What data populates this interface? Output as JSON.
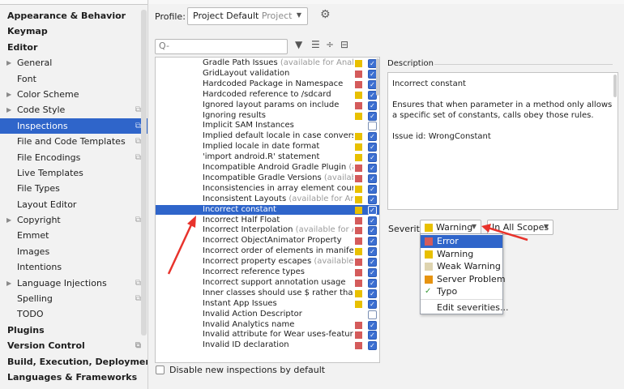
{
  "sidebar": {
    "items": [
      {
        "label": "Appearance & Behavior",
        "level": 0,
        "bold": true
      },
      {
        "label": "Keymap",
        "level": 0,
        "bold": true
      },
      {
        "label": "Editor",
        "level": 0,
        "bold": true
      },
      {
        "label": "General",
        "level": 1,
        "arrow": true
      },
      {
        "label": "Font",
        "level": 1
      },
      {
        "label": "Color Scheme",
        "level": 1,
        "arrow": true
      },
      {
        "label": "Code Style",
        "level": 1,
        "arrow": true,
        "project": true
      },
      {
        "label": "Inspections",
        "level": 1,
        "project": true,
        "selected": true
      },
      {
        "label": "File and Code Templates",
        "level": 1,
        "project": true
      },
      {
        "label": "File Encodings",
        "level": 1,
        "project": true
      },
      {
        "label": "Live Templates",
        "level": 1
      },
      {
        "label": "File Types",
        "level": 1
      },
      {
        "label": "Layout Editor",
        "level": 1
      },
      {
        "label": "Copyright",
        "level": 1,
        "arrow": true,
        "project": true
      },
      {
        "label": "Emmet",
        "level": 1
      },
      {
        "label": "Images",
        "level": 1
      },
      {
        "label": "Intentions",
        "level": 1
      },
      {
        "label": "Language Injections",
        "level": 1,
        "arrow": true,
        "project": true
      },
      {
        "label": "Spelling",
        "level": 1,
        "project": true
      },
      {
        "label": "TODO",
        "level": 1
      },
      {
        "label": "Plugins",
        "level": 0,
        "bold": true
      },
      {
        "label": "Version Control",
        "level": 0,
        "bold": true,
        "project": true
      },
      {
        "label": "Build, Execution, Deployment",
        "level": 0,
        "bold": true
      },
      {
        "label": "Languages & Frameworks",
        "level": 0,
        "bold": true
      }
    ]
  },
  "profile": {
    "label": "Profile:",
    "value": "Project Default",
    "value_suffix": "Project"
  },
  "search": {
    "placeholder": "Q-"
  },
  "severity_colors": {
    "error": "#d45b5b",
    "warning": "#e8c000",
    "weak": "#ded4b0",
    "server": "#e69310"
  },
  "inspections": [
    {
      "name": "Gradle Path Issues",
      "note": "(available for Analyze",
      "sev": "warning",
      "on": true
    },
    {
      "name": "GridLayout validation",
      "note": "",
      "sev": "error",
      "on": true
    },
    {
      "name": "Hardcoded Package in Namespace",
      "note": "",
      "sev": "error",
      "on": true
    },
    {
      "name": "Hardcoded reference to /sdcard",
      "note": "",
      "sev": "warning",
      "on": true
    },
    {
      "name": "Ignored layout params on include",
      "note": "",
      "sev": "error",
      "on": true
    },
    {
      "name": "Ignoring results",
      "note": "",
      "sev": "warning",
      "on": true
    },
    {
      "name": "Implicit SAM Instances",
      "note": "",
      "sev": "",
      "on": false
    },
    {
      "name": "Implied default locale in case conversion",
      "note": "",
      "sev": "warning",
      "on": true
    },
    {
      "name": "Implied locale in date format",
      "note": "",
      "sev": "warning",
      "on": true
    },
    {
      "name": "'import android.R' statement",
      "note": "",
      "sev": "warning",
      "on": true
    },
    {
      "name": "Incompatible Android Gradle Plugin",
      "note": "(avai",
      "sev": "error",
      "on": true
    },
    {
      "name": "Incompatible Gradle Versions",
      "note": "(available f",
      "sev": "error",
      "on": true
    },
    {
      "name": "Inconsistencies in array element counts",
      "note": "",
      "sev": "warning",
      "on": true
    },
    {
      "name": "Inconsistent Layouts",
      "note": "(available for Analyz",
      "sev": "warning",
      "on": true
    },
    {
      "name": "Incorrect constant",
      "note": "",
      "sev": "warning",
      "on": true,
      "selected": true
    },
    {
      "name": "Incorrect Half Float",
      "note": "",
      "sev": "error",
      "on": true
    },
    {
      "name": "Incorrect Interpolation",
      "note": "(available for Anal",
      "sev": "error",
      "on": true
    },
    {
      "name": "Incorrect ObjectAnimator Property",
      "note": "",
      "sev": "error",
      "on": true
    },
    {
      "name": "Incorrect order of elements in manifest",
      "note": "",
      "sev": "warning",
      "on": true
    },
    {
      "name": "Incorrect property escapes",
      "note": "(available for",
      "sev": "error",
      "on": true
    },
    {
      "name": "Incorrect reference types",
      "note": "",
      "sev": "error",
      "on": true
    },
    {
      "name": "Incorrect support annotation usage",
      "note": "",
      "sev": "error",
      "on": true
    },
    {
      "name": "Inner classes should use $ rather than .",
      "note": "",
      "sev": "warning",
      "on": true
    },
    {
      "name": "Instant App Issues",
      "note": "",
      "sev": "warning",
      "on": true
    },
    {
      "name": "Invalid Action Descriptor",
      "note": "",
      "sev": "",
      "on": false
    },
    {
      "name": "Invalid Analytics name",
      "note": "",
      "sev": "error",
      "on": true
    },
    {
      "name": "Invalid attribute for Wear uses-feature",
      "note": "",
      "sev": "error",
      "on": true
    },
    {
      "name": "Invalid ID declaration",
      "note": "",
      "sev": "error",
      "on": true
    }
  ],
  "description": {
    "label": "Description",
    "title": "Incorrect constant",
    "body": "Ensures that when parameter in a method only allows a specific set of constants, calls obey those rules.",
    "issue_id": "Issue id: WrongConstant"
  },
  "severity": {
    "label": "Severity:",
    "value": "Warning",
    "scope": "In All Scopes",
    "menu": [
      {
        "label": "Error",
        "sev": "error",
        "selected": true
      },
      {
        "label": "Warning",
        "sev": "warning"
      },
      {
        "label": "Weak Warning",
        "sev": "weak"
      },
      {
        "label": "Server Problem",
        "sev": "server"
      },
      {
        "label": "Typo",
        "sev": "typo"
      },
      {
        "label": "Edit severities...",
        "sev": ""
      }
    ]
  },
  "footer": {
    "disable_label": "Disable new inspections by default"
  },
  "annotation_color": "#e8332c"
}
